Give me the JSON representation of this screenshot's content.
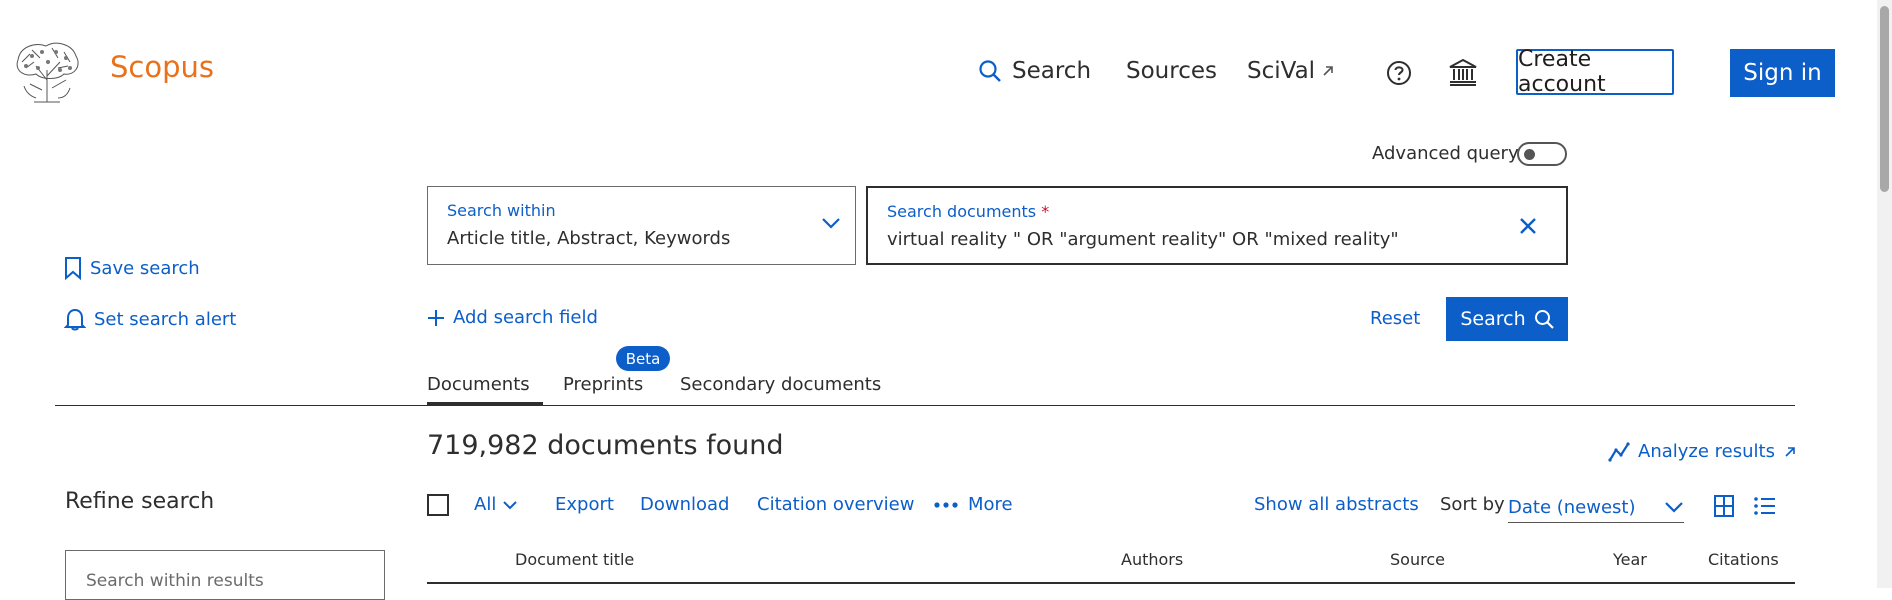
{
  "header": {
    "brand": "Scopus",
    "nav": {
      "search": "Search",
      "sources": "Sources",
      "scival": "SciVal"
    },
    "create_account": "Create account",
    "sign_in": "Sign in"
  },
  "advanced_query": {
    "label": "Advanced query",
    "enabled": false
  },
  "search_within": {
    "label": "Search within",
    "value": "Article title, Abstract, Keywords"
  },
  "search_documents": {
    "label": "Search documents",
    "required_mark": "*",
    "value": "virtual reality \" OR \"argument reality\" OR \"mixed reality\""
  },
  "sidebar": {
    "save_search": "Save search",
    "set_search_alert": "Set search alert",
    "refine_search": "Refine search",
    "search_within_results_placeholder": "Search within results"
  },
  "actions": {
    "add_search_field": "Add search field",
    "reset": "Reset",
    "search": "Search"
  },
  "tabs": {
    "documents": "Documents",
    "preprints": "Preprints",
    "beta_badge": "Beta",
    "secondary_documents": "Secondary documents",
    "active": "documents"
  },
  "results": {
    "count_text": "719,982 documents found",
    "analyze_results": "Analyze results"
  },
  "toolbar": {
    "all": "All",
    "export": "Export",
    "download": "Download",
    "citation_overview": "Citation overview",
    "more": "More",
    "show_all_abstracts": "Show all abstracts",
    "sort_by_label": "Sort by",
    "sort_value": "Date (newest)"
  },
  "table": {
    "columns": [
      "Document title",
      "Authors",
      "Source",
      "Year",
      "Citations"
    ]
  },
  "colors": {
    "accent": "#0c5ec8",
    "brand": "#e9711c",
    "text": "#2e2e2e"
  }
}
